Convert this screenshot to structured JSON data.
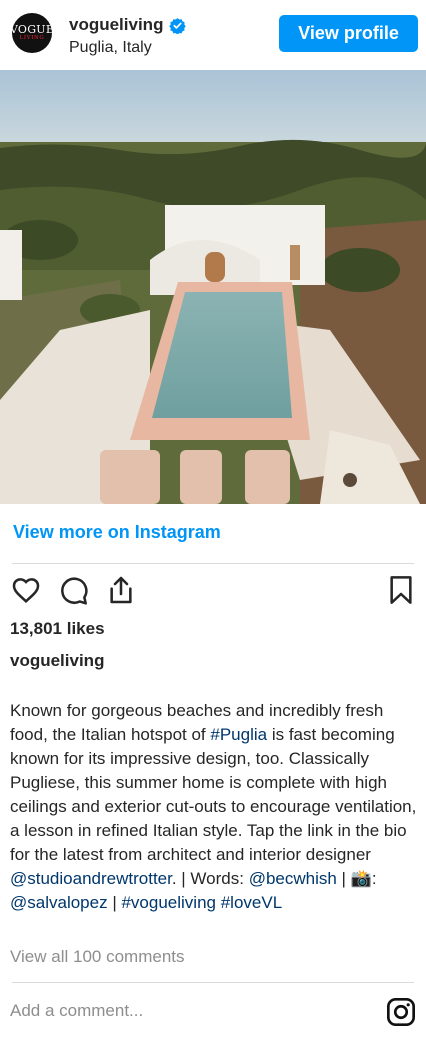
{
  "header": {
    "avatar_text": "VOGUE",
    "avatar_subtext": "LIVING",
    "username": "vogueliving",
    "verified": true,
    "location": "Puglia, Italy",
    "view_profile_label": "View profile"
  },
  "post": {
    "image_icon": "photo-puglia-villa-pool",
    "view_more_label": "View more on Instagram",
    "likes": "13,801 likes",
    "owner": "vogueliving",
    "caption": {
      "p1": "Known for gorgeous beaches and incredibly fresh food, the Italian hotspot of ",
      "tag_puglia": "#Puglia",
      "p2": " is fast becoming known for its impressive design, too. Classically Pugliese, this summer home is complete with high ceilings and exterior cut-outs to encourage ventilation, a lesson in refined Italian style. Tap the link in the bio for the latest from architect and interior designer ",
      "mention_studio": "@studioandrewtrotter",
      "p3": ". | Words: ",
      "mention_bec": "@becwhish",
      "p4": " | ",
      "camera_emoji": "📸",
      "p5": ": ",
      "mention_salva": "@salvalopez",
      "p6": " | ",
      "tag_vogue": "#vogueliving",
      "p7": " ",
      "tag_lovevl": "#loveVL"
    },
    "comments_label": "View all 100 comments",
    "add_comment_placeholder": "Add a comment..."
  },
  "colors": {
    "accent": "#0095f6",
    "link": "#00376b",
    "muted": "#8e8e8e",
    "text": "#262626",
    "divider": "#dbdbdb"
  }
}
